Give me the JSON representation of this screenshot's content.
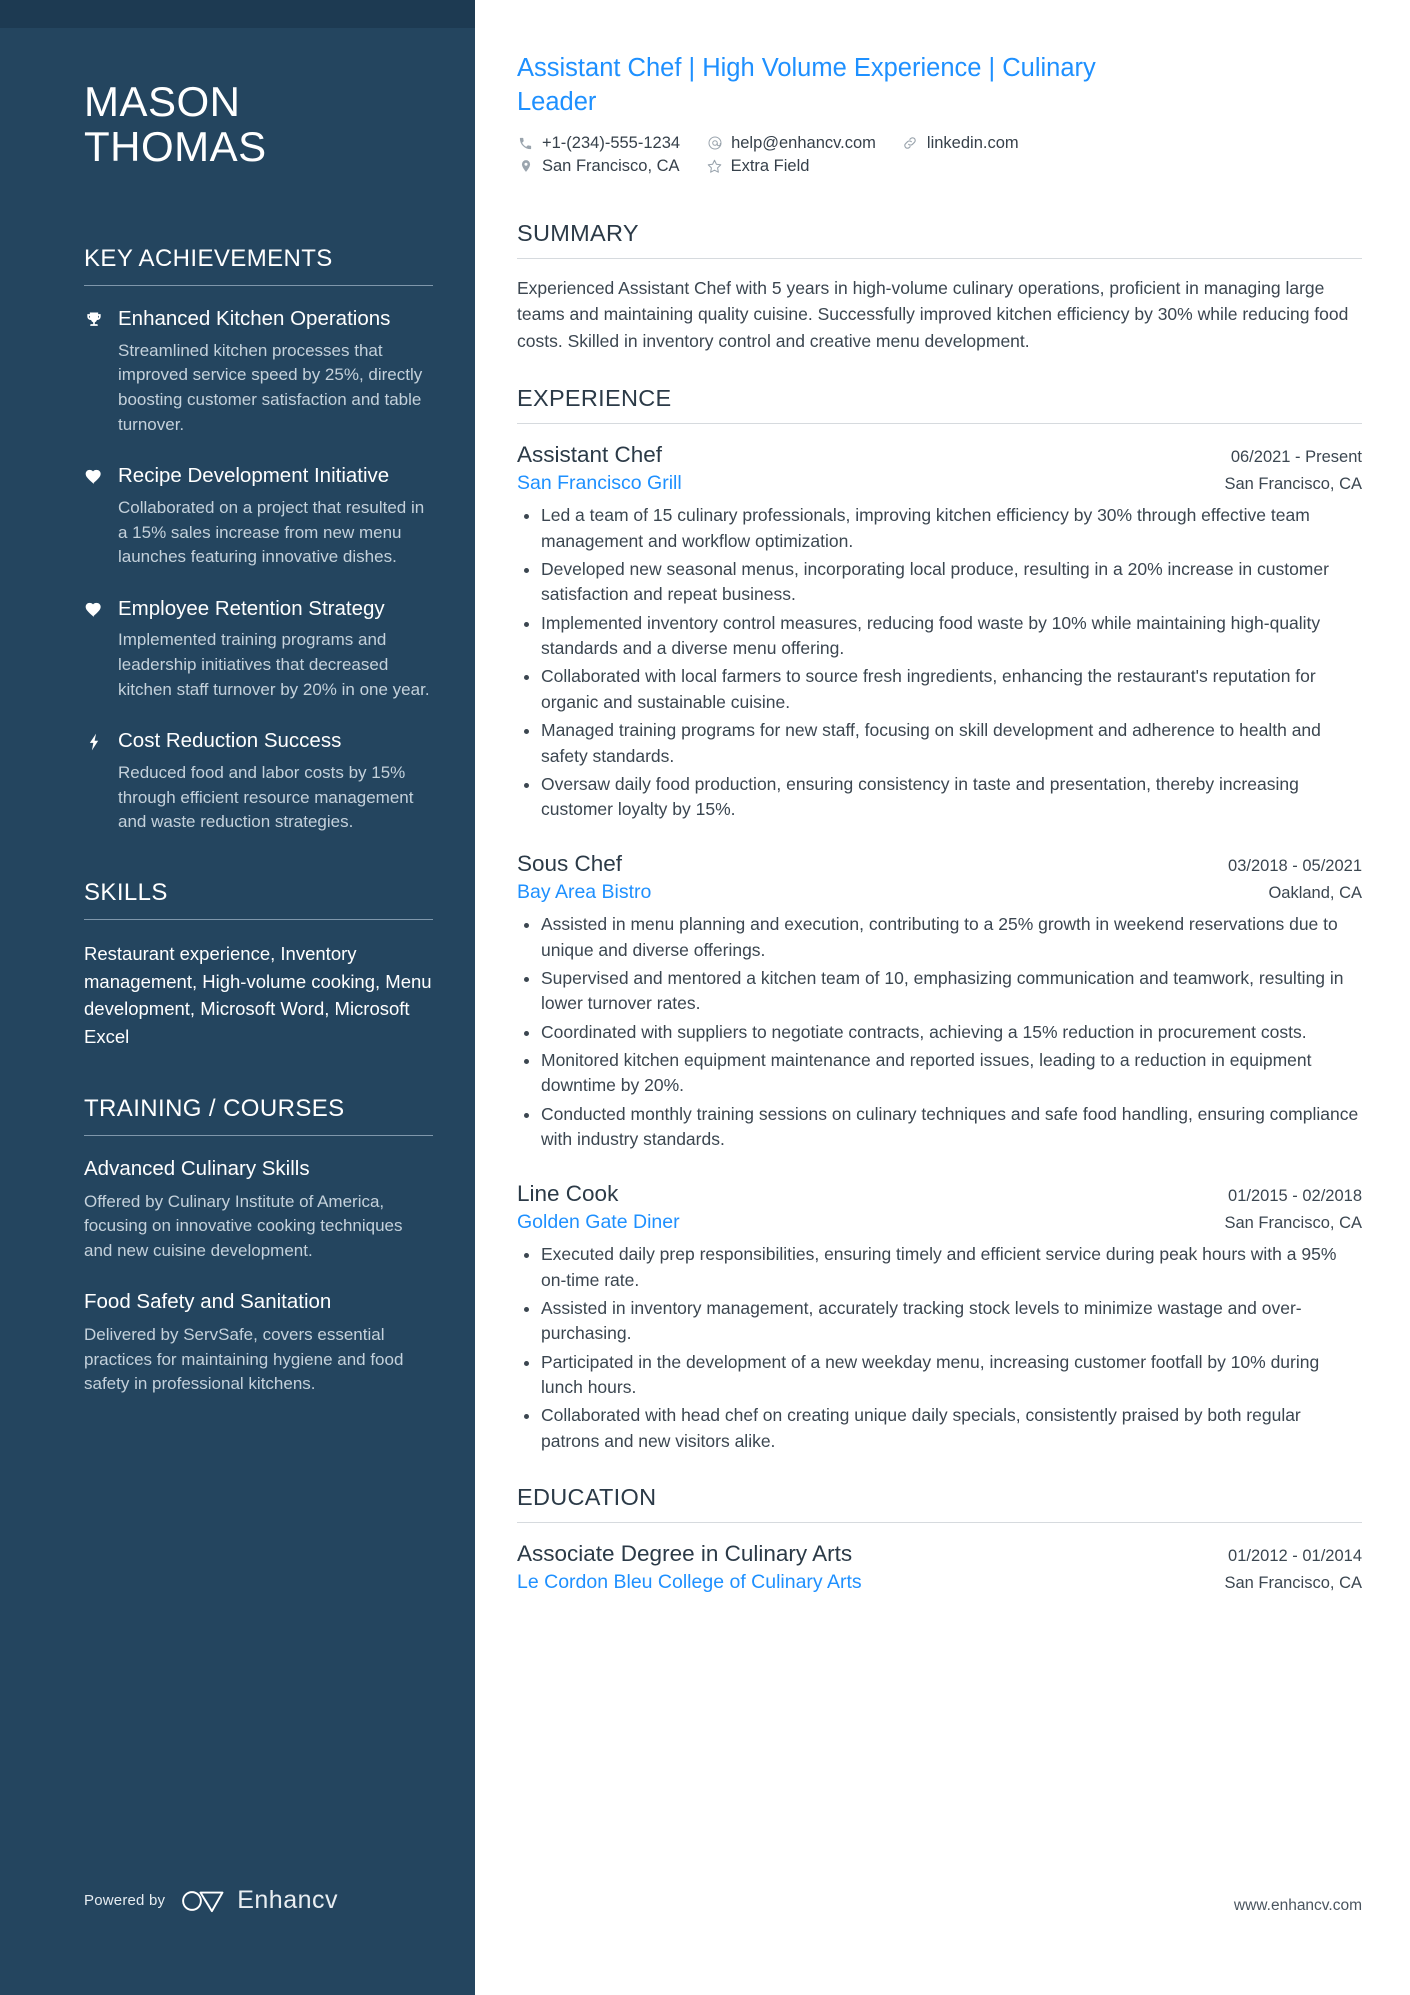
{
  "sidebar": {
    "name_lines": [
      "MASON",
      "THOMAS"
    ],
    "achievements_section": {
      "title": "KEY ACHIEVEMENTS",
      "items": [
        {
          "icon": "trophy-icon",
          "title": "Enhanced Kitchen Operations",
          "description": "Streamlined kitchen processes that improved service speed by 25%, directly boosting customer satisfaction and table turnover."
        },
        {
          "icon": "heart-icon",
          "title": "Recipe Development Initiative",
          "description": "Collaborated on a project that resulted in a 15% sales increase from new menu launches featuring innovative dishes."
        },
        {
          "icon": "heart-icon",
          "title": "Employee Retention Strategy",
          "description": "Implemented training programs and leadership initiatives that decreased kitchen staff turnover by 20% in one year."
        },
        {
          "icon": "lightning-bolt-icon",
          "title": "Cost Reduction Success",
          "description": "Reduced food and labor costs by 15% through efficient resource management and waste reduction strategies."
        }
      ]
    },
    "skills_section": {
      "title": "SKILLS",
      "text": "Restaurant experience, Inventory management, High-volume cooking, Menu development, Microsoft Word, Microsoft Excel"
    },
    "training_section": {
      "title": "TRAINING / COURSES",
      "items": [
        {
          "title": "Advanced Culinary Skills",
          "description": "Offered by Culinary Institute of America, focusing on innovative cooking techniques and new cuisine development."
        },
        {
          "title": "Food Safety and Sanitation",
          "description": "Delivered by ServSafe, covers essential practices for maintaining hygiene and food safety in professional kitchens."
        }
      ]
    },
    "footer": {
      "powered_by": "Powered by",
      "brand": "Enhancv"
    }
  },
  "main": {
    "headline": "Assistant Chef | High Volume Experience | Culinary Leader",
    "contact": {
      "row1": [
        {
          "icon": "phone-icon",
          "value": "+1-(234)-555-1234"
        },
        {
          "icon": "at-email-icon",
          "value": "help@enhancv.com"
        },
        {
          "icon": "link-icon",
          "value": "linkedin.com"
        }
      ],
      "row2": [
        {
          "icon": "location-pin-icon",
          "value": "San Francisco, CA"
        },
        {
          "icon": "star-icon",
          "value": "Extra Field"
        }
      ]
    },
    "summary_section": {
      "title": "SUMMARY",
      "text": "Experienced Assistant Chef with 5 years in high-volume culinary operations, proficient in managing large teams and maintaining quality cuisine. Successfully improved kitchen efficiency by 30% while reducing food costs. Skilled in inventory control and creative menu development."
    },
    "experience_section": {
      "title": "EXPERIENCE",
      "entries": [
        {
          "title": "Assistant Chef",
          "date": "06/2021 - Present",
          "organization": "San Francisco Grill",
          "location": "San Francisco, CA",
          "bullets": [
            "Led a team of 15 culinary professionals, improving kitchen efficiency by 30% through effective team management and workflow optimization.",
            "Developed new seasonal menus, incorporating local produce, resulting in a 20% increase in customer satisfaction and repeat business.",
            "Implemented inventory control measures, reducing food waste by 10% while maintaining high-quality standards and a diverse menu offering.",
            "Collaborated with local farmers to source fresh ingredients, enhancing the restaurant's reputation for organic and sustainable cuisine.",
            "Managed training programs for new staff, focusing on skill development and adherence to health and safety standards.",
            "Oversaw daily food production, ensuring consistency in taste and presentation, thereby increasing customer loyalty by 15%."
          ]
        },
        {
          "title": "Sous Chef",
          "date": "03/2018 - 05/2021",
          "organization": "Bay Area Bistro",
          "location": "Oakland, CA",
          "bullets": [
            "Assisted in menu planning and execution, contributing to a 25% growth in weekend reservations due to unique and diverse offerings.",
            "Supervised and mentored a kitchen team of 10, emphasizing communication and teamwork, resulting in lower turnover rates.",
            "Coordinated with suppliers to negotiate contracts, achieving a 15% reduction in procurement costs.",
            "Monitored kitchen equipment maintenance and reported issues, leading to a reduction in equipment downtime by 20%.",
            "Conducted monthly training sessions on culinary techniques and safe food handling, ensuring compliance with industry standards."
          ]
        },
        {
          "title": "Line Cook",
          "date": "01/2015 - 02/2018",
          "organization": "Golden Gate Diner",
          "location": "San Francisco, CA",
          "bullets": [
            "Executed daily prep responsibilities, ensuring timely and efficient service during peak hours with a 95% on-time rate.",
            "Assisted in inventory management, accurately tracking stock levels to minimize wastage and over-purchasing.",
            "Participated in the development of a new weekday menu, increasing customer footfall by 10% during lunch hours.",
            "Collaborated with head chef on creating unique daily specials, consistently praised by both regular patrons and new visitors alike."
          ]
        }
      ]
    },
    "education_section": {
      "title": "EDUCATION",
      "entries": [
        {
          "title": "Associate Degree in Culinary Arts",
          "date": "01/2012 - 01/2014",
          "organization": "Le Cordon Bleu College of Culinary Arts",
          "location": "San Francisco, CA"
        }
      ]
    },
    "footer_url": "www.enhancv.com"
  }
}
